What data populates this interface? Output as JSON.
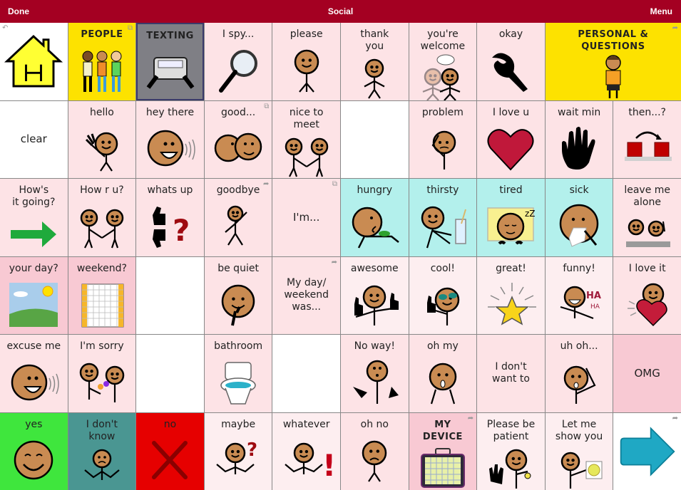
{
  "topbar": {
    "done_label": "Done",
    "title": "Social",
    "menu_label": "Menu"
  },
  "colors": {
    "topbar": "#a40022",
    "pink": "#fde3e6",
    "light_pink": "#fdeef0",
    "deep_pink": "#f8c9d3",
    "cyan": "#b3f0ec",
    "yellow": "#fde200",
    "gray": "#7f7f85",
    "green": "#3fe63d",
    "teal": "#4a9692",
    "red": "#e60000",
    "white": "#ffffff"
  },
  "cells": [
    {
      "label": "",
      "icon": "home-icon",
      "bg": "white",
      "corner": "back-icon"
    },
    {
      "label": "PEOPLE",
      "icon": "people-icon",
      "bg": "yellow",
      "corner": "folder-icon"
    },
    {
      "label": "TEXTING",
      "icon": "phone-texting-icon",
      "bg": "gray"
    },
    {
      "label": "I spy...",
      "icon": "magnifier-icon",
      "bg": "pink"
    },
    {
      "label": "please",
      "icon": "person-please-icon",
      "bg": "pink"
    },
    {
      "label": "thank\nyou",
      "icon": "person-thanks-icon",
      "bg": "pink"
    },
    {
      "label": "you're\nwelcome",
      "icon": "two-people-talk-icon",
      "bg": "pink"
    },
    {
      "label": "okay",
      "icon": "ok-hand-icon",
      "bg": "pink"
    },
    {
      "label": "PERSONAL &\nQUESTIONS",
      "icon": "boy-icon",
      "bg": "yellow",
      "span": 2,
      "corner": "link-icon"
    },
    {
      "label": "clear",
      "icon": "",
      "bg": "white",
      "center": true
    },
    {
      "label": "hello",
      "icon": "wave-icon",
      "bg": "pink"
    },
    {
      "label": "hey there",
      "icon": "shout-face-icon",
      "bg": "pink"
    },
    {
      "label": "good...",
      "icon": "kiss-icon",
      "bg": "pink",
      "corner": "folder-icon"
    },
    {
      "label": "nice to\nmeet",
      "icon": "handshake-icon",
      "bg": "pink"
    },
    {
      "label": "",
      "icon": "",
      "bg": "white"
    },
    {
      "label": "problem",
      "icon": "worried-person-icon",
      "bg": "pink"
    },
    {
      "label": "I love u",
      "icon": "heart-icon",
      "bg": "pink"
    },
    {
      "label": "wait min",
      "icon": "stop-hand-icon",
      "bg": "pink"
    },
    {
      "label": "then...?",
      "icon": "then-blocks-icon",
      "bg": "pink"
    },
    {
      "label": "How's\nit going?",
      "icon": "green-arrow-icon",
      "bg": "pink"
    },
    {
      "label": "How r u?",
      "icon": "handshake-icon",
      "bg": "pink"
    },
    {
      "label": "whats up",
      "icon": "thumbs-question-icon",
      "bg": "pink"
    },
    {
      "label": "goodbye",
      "icon": "walk-wave-icon",
      "bg": "pink",
      "corner": "link-icon"
    },
    {
      "label": "I'm...",
      "icon": "",
      "bg": "pink",
      "center": true,
      "corner": "folder-icon"
    },
    {
      "label": "hungry",
      "icon": "eating-icon",
      "bg": "cyan"
    },
    {
      "label": "thirsty",
      "icon": "drink-icon",
      "bg": "cyan"
    },
    {
      "label": "tired",
      "icon": "sleep-icon",
      "bg": "cyan"
    },
    {
      "label": "sick",
      "icon": "sick-icon",
      "bg": "cyan"
    },
    {
      "label": "leave me\nalone",
      "icon": "leave-alone-icon",
      "bg": "pink"
    },
    {
      "label": "your day?",
      "icon": "sunny-sky-icon",
      "bg": "deep_pink"
    },
    {
      "label": "weekend?",
      "icon": "calendar-icon",
      "bg": "deep_pink"
    },
    {
      "label": "",
      "icon": "",
      "bg": "white"
    },
    {
      "label": "be quiet",
      "icon": "shush-icon",
      "bg": "pink"
    },
    {
      "label": "My day/\nweekend\nwas...",
      "icon": "",
      "bg": "pink",
      "center": true,
      "corner": "link-icon"
    },
    {
      "label": "awesome",
      "icon": "thumbs-up-person-icon",
      "bg": "light_pink"
    },
    {
      "label": "cool!",
      "icon": "sunglasses-icon",
      "bg": "light_pink"
    },
    {
      "label": "great!",
      "icon": "star-icon",
      "bg": "light_pink"
    },
    {
      "label": "funny!",
      "icon": "laugh-icon",
      "bg": "light_pink"
    },
    {
      "label": "I love it",
      "icon": "hug-heart-icon",
      "bg": "pink"
    },
    {
      "label": "excuse me",
      "icon": "shout-face-icon",
      "bg": "pink"
    },
    {
      "label": "I'm sorry",
      "icon": "sorry-flowers-icon",
      "bg": "pink"
    },
    {
      "label": "",
      "icon": "",
      "bg": "white"
    },
    {
      "label": "bathroom",
      "icon": "toilet-icon",
      "bg": "pink"
    },
    {
      "label": "",
      "icon": "",
      "bg": "white"
    },
    {
      "label": "No way!",
      "icon": "no-way-icon",
      "bg": "pink"
    },
    {
      "label": "oh my",
      "icon": "surprised-icon",
      "bg": "pink"
    },
    {
      "label": "I don't\nwant to",
      "icon": "",
      "bg": "pink",
      "center": true
    },
    {
      "label": "uh oh...",
      "icon": "uh-oh-icon",
      "bg": "pink"
    },
    {
      "label": "OMG",
      "icon": "",
      "bg": "deep_pink",
      "center": true
    },
    {
      "label": "yes",
      "icon": "happy-face-icon",
      "bg": "green"
    },
    {
      "label": "I don't\nknow",
      "icon": "shrug-icon",
      "bg": "teal"
    },
    {
      "label": "no",
      "icon": "x-mark-icon",
      "bg": "red"
    },
    {
      "label": "maybe",
      "icon": "shrug-question-icon",
      "bg": "light_pink"
    },
    {
      "label": "whatever",
      "icon": "shrug-exclaim-icon",
      "bg": "light_pink"
    },
    {
      "label": "oh no",
      "icon": "sad-person-icon",
      "bg": "pink"
    },
    {
      "label": "MY\nDEVICE",
      "icon": "device-icon",
      "bg": "deep_pink",
      "corner": "link-icon"
    },
    {
      "label": "Please be\npatient",
      "icon": "patient-icon",
      "bg": "light_pink"
    },
    {
      "label": "Let me\nshow you",
      "icon": "show-flower-icon",
      "bg": "light_pink"
    },
    {
      "label": "",
      "icon": "next-arrow-icon",
      "bg": "white",
      "corner": "link-icon"
    }
  ]
}
